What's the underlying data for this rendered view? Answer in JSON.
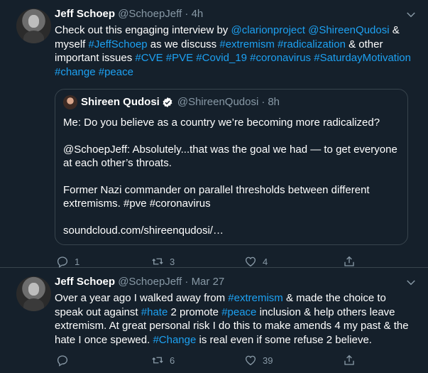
{
  "tweets": [
    {
      "author": {
        "name": "Jeff Schoep",
        "handle": "@SchoepJeff"
      },
      "sep": "·",
      "time": "4h",
      "text_parts": [
        {
          "t": "Check out this engaging interview by ",
          "link": false
        },
        {
          "t": "@clarionproject",
          "link": true
        },
        {
          "t": "  ",
          "link": false
        },
        {
          "t": "@ShireenQudosi",
          "link": true
        },
        {
          "t": " & myself ",
          "link": false
        },
        {
          "t": "#JeffSchoep",
          "link": true
        },
        {
          "t": " as we discuss ",
          "link": false
        },
        {
          "t": "#extremism",
          "link": true
        },
        {
          "t": " ",
          "link": false
        },
        {
          "t": "#radicalization",
          "link": true
        },
        {
          "t": " & other important issues ",
          "link": false
        },
        {
          "t": "#CVE",
          "link": true
        },
        {
          "t": " ",
          "link": false
        },
        {
          "t": "#PVE",
          "link": true
        },
        {
          "t": " ",
          "link": false
        },
        {
          "t": "#Covid_19",
          "link": true
        },
        {
          "t": " ",
          "link": false
        },
        {
          "t": "#coronavirus",
          "link": true
        },
        {
          "t": " ",
          "link": false
        },
        {
          "t": "#SaturdayMotivation",
          "link": true
        },
        {
          "t": " ",
          "link": false
        },
        {
          "t": "#change",
          "link": true
        },
        {
          "t": " ",
          "link": false
        },
        {
          "t": "#peace",
          "link": true
        }
      ],
      "quote": {
        "name": "Shireen Qudosi",
        "handle": "@ShireenQudosi",
        "sep": "·",
        "time": "8h",
        "paragraphs": [
          "Me: Do you believe as a country we’re becoming more radicalized?",
          "@SchoepJeff: Absolutely...that was the goal we had — to get everyone at each other’s throats.",
          "Former Nazi commander on parallel thresholds between different extremisms. #pve #coronavirus",
          "soundcloud.com/shireenqudosi/…"
        ]
      },
      "actions": {
        "replies": "1",
        "retweets": "3",
        "likes": "4"
      }
    },
    {
      "author": {
        "name": "Jeff Schoep",
        "handle": "@SchoepJeff"
      },
      "sep": "·",
      "time": "Mar 27",
      "text_parts": [
        {
          "t": "Over a year ago I walked away from ",
          "link": false
        },
        {
          "t": "#extremism",
          "link": true
        },
        {
          "t": " & made the choice to speak out against ",
          "link": false
        },
        {
          "t": "#hate",
          "link": true
        },
        {
          "t": " 2 promote ",
          "link": false
        },
        {
          "t": "#peace",
          "link": true
        },
        {
          "t": " inclusion & help others leave extremism. At great personal risk I do this to make amends 4 my past & the hate I once spewed. ",
          "link": false
        },
        {
          "t": "#Change",
          "link": true
        },
        {
          "t": " is real even if some refuse 2 believe.",
          "link": false
        }
      ],
      "actions": {
        "replies": "",
        "retweets": "6",
        "likes": "39"
      }
    }
  ],
  "colors": {
    "background": "#15202b",
    "link": "#1da1f2",
    "muted": "#8899a6",
    "border": "#38444d"
  },
  "icons": [
    "reply-icon",
    "retweet-icon",
    "like-icon",
    "share-icon",
    "caret-down-icon",
    "verified-badge-icon"
  ]
}
